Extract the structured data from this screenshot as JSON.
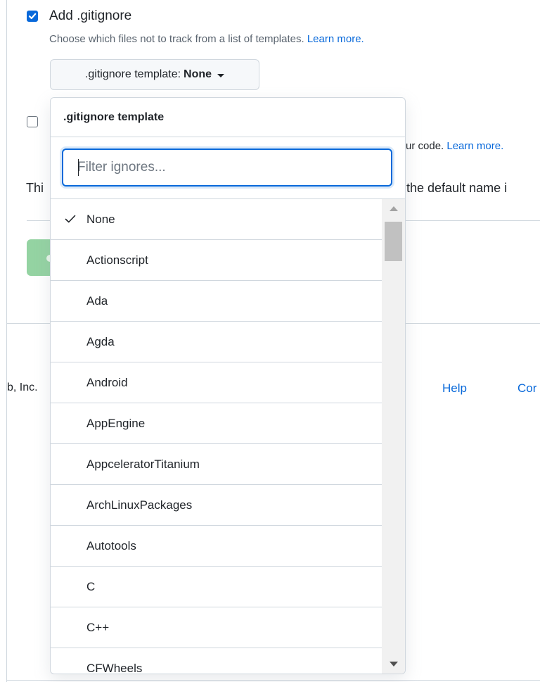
{
  "gitignore": {
    "checkbox_checked": true,
    "title": "Add .gitignore",
    "description": "Choose which files not to track from a list of templates.",
    "learn_more": "Learn more.",
    "template_button_prefix": ".gitignore template:",
    "template_button_value": "None"
  },
  "license_row": {
    "checked": false,
    "partial_text": "ur code.",
    "learn_more": "Learn more."
  },
  "background": {
    "partial_prefix": "Thi",
    "partial_suffix": "the default name i",
    "footer_company": "b, Inc.",
    "footer_help": "Help",
    "footer_partial": "Cor"
  },
  "dropdown": {
    "header": ".gitignore template",
    "filter_placeholder": "Filter ignores...",
    "filter_value": "",
    "selected": "None",
    "items": [
      {
        "label": "None",
        "selected": true
      },
      {
        "label": "Actionscript",
        "selected": false
      },
      {
        "label": "Ada",
        "selected": false
      },
      {
        "label": "Agda",
        "selected": false
      },
      {
        "label": "Android",
        "selected": false
      },
      {
        "label": "AppEngine",
        "selected": false
      },
      {
        "label": "AppceleratorTitanium",
        "selected": false
      },
      {
        "label": "ArchLinuxPackages",
        "selected": false
      },
      {
        "label": "Autotools",
        "selected": false
      },
      {
        "label": "C",
        "selected": false
      },
      {
        "label": "C++",
        "selected": false
      },
      {
        "label": "CFWheels",
        "selected": false
      }
    ]
  },
  "colors": {
    "accent": "#0969da",
    "border": "#d0d7de",
    "create_button": "#94d3a2"
  },
  "icons": {
    "checkmark": "check-icon",
    "caret": "triangle-down-icon"
  }
}
